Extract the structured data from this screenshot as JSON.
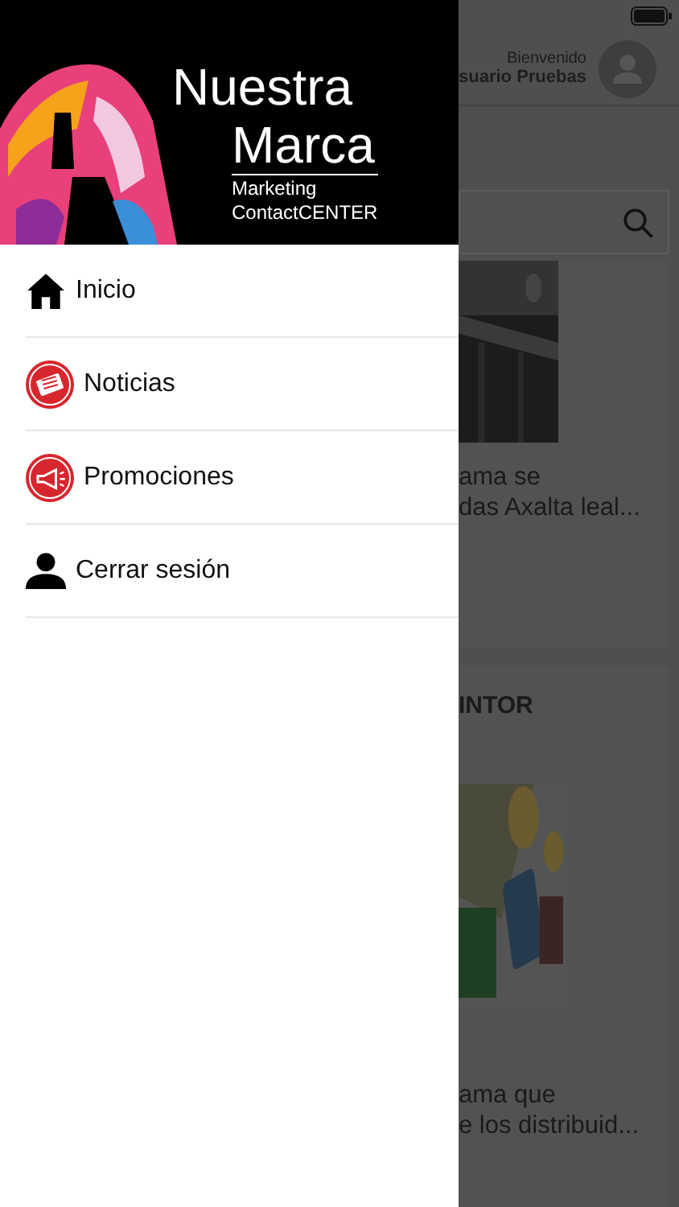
{
  "drawer": {
    "brand": {
      "title_lines": [
        "Nuestra",
        "Marca"
      ],
      "subtitle_lines": [
        "Marketing",
        "ContactCENTER"
      ]
    },
    "menu": [
      {
        "label": "Inicio",
        "kind": "home"
      },
      {
        "label": "Noticias",
        "kind": "news"
      },
      {
        "label": "Promociones",
        "kind": "promo"
      },
      {
        "label": "Cerrar sesión",
        "kind": "logout"
      }
    ]
  },
  "background": {
    "header": {
      "greeting": "Bienvenido",
      "user_name": "suario Pruebas"
    },
    "cards": [
      {
        "text_lines": [
          "ama se",
          "das Axalta leal..."
        ]
      },
      {
        "title": "INTOR",
        "text_lines": [
          "ama que",
          "e los distribuid..."
        ]
      }
    ]
  }
}
